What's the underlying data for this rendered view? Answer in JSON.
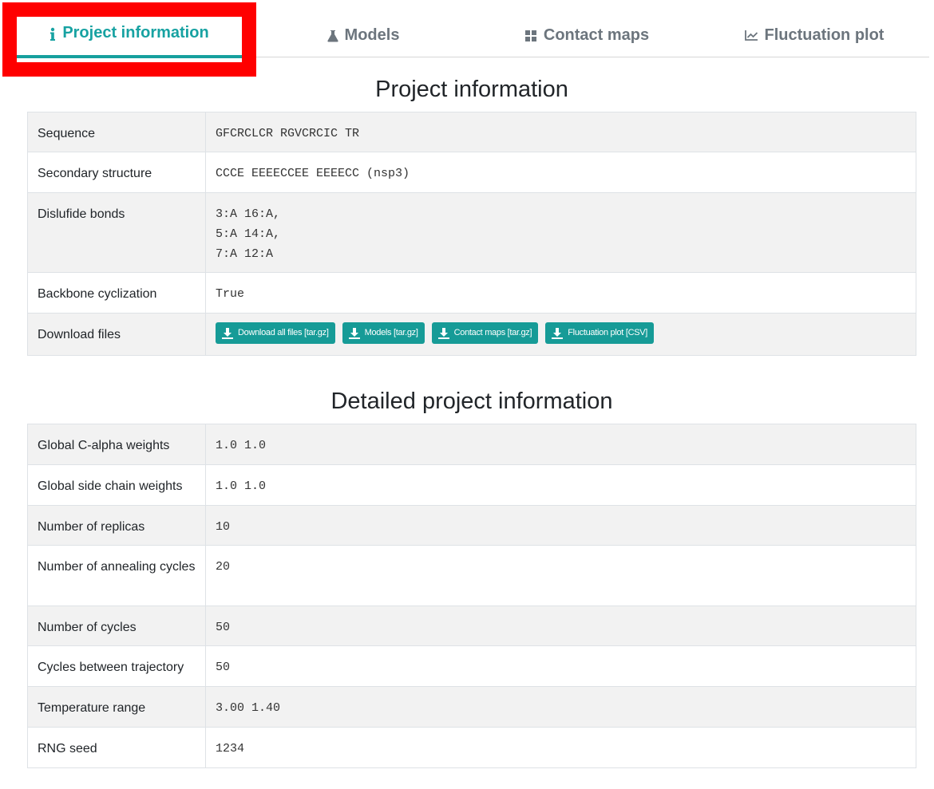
{
  "tabs": [
    {
      "label": "Project information",
      "icon": "info-icon",
      "active": true
    },
    {
      "label": "Models",
      "icon": "flask-icon",
      "active": false
    },
    {
      "label": "Contact maps",
      "icon": "grid-icon",
      "active": false
    },
    {
      "label": "Fluctuation plot",
      "icon": "line-chart-icon",
      "active": false
    }
  ],
  "colors": {
    "accent": "#16a09e",
    "highlight": "#ff0000",
    "stripe": "#f2f2f2",
    "inactive_tab": "#6c757d"
  },
  "project": {
    "title": "Project information",
    "rows": {
      "sequence": {
        "label": "Sequence",
        "value": "GFCRCLCR RGVCRCIC TR"
      },
      "secondary": {
        "label": "Secondary structure",
        "value": "CCCE EEEECCEE EEEECC (nsp3)"
      },
      "disulfide": {
        "label": "Dislufide bonds",
        "lines": [
          "3:A 16:A,",
          "5:A 14:A,",
          "7:A 12:A"
        ]
      },
      "cyclization": {
        "label": "Backbone cyclization",
        "value": "True"
      },
      "download": {
        "label": "Download files",
        "buttons": [
          "Download all files [tar.gz]",
          "Models [tar.gz]",
          "Contact maps [tar.gz]",
          "Fluctuation plot [CSV]"
        ]
      }
    }
  },
  "detailed": {
    "title": "Detailed project information",
    "rows": [
      {
        "label": "Global C-alpha weights",
        "value": "1.0 1.0"
      },
      {
        "label": "Global side chain weights",
        "value": "1.0 1.0"
      },
      {
        "label": "Number of replicas",
        "value": "10"
      },
      {
        "label": "Number of annealing cycles",
        "value": "20"
      },
      {
        "label": "Number of cycles",
        "value": "50"
      },
      {
        "label": "Cycles between trajectory",
        "value": "50"
      },
      {
        "label": "Temperature range",
        "value": "3.00 1.40"
      },
      {
        "label": "RNG seed",
        "value": "1234"
      }
    ]
  }
}
